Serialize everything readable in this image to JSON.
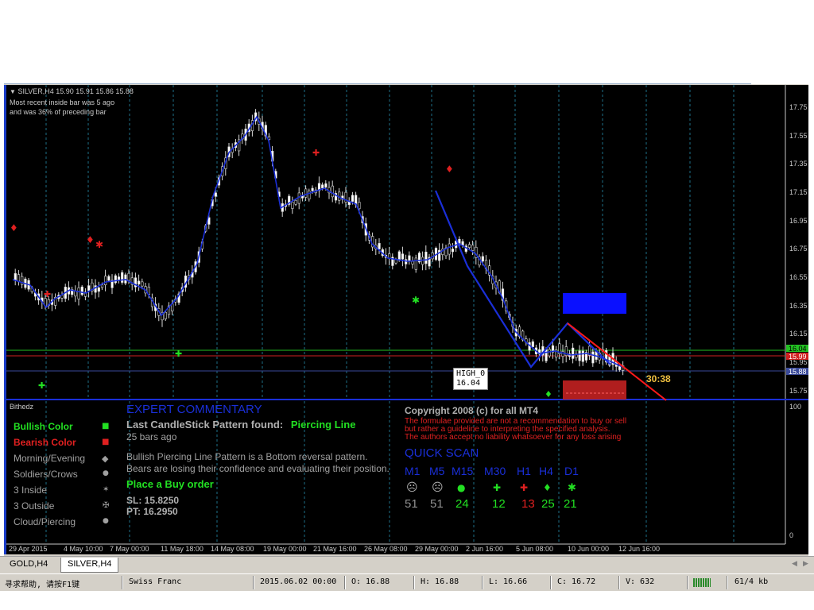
{
  "window": {
    "symbol_title": "SILVER,H4  15.90 15.91 15.86 15.88",
    "inside_bar_line1": "Most recent inside bar was 5 ago",
    "inside_bar_line2": "and was 36% of preceding bar"
  },
  "price_axis": [
    "17.75",
    "17.55",
    "17.35",
    "17.15",
    "16.95",
    "16.75",
    "16.55",
    "16.35",
    "16.15",
    "15.95",
    "15.75"
  ],
  "price_tags": {
    "green": "16.04",
    "red": "15.99",
    "blue": "15.88"
  },
  "indicator_axis": {
    "top": "100",
    "bottom": "0"
  },
  "time_axis": [
    "29 Apr 2015",
    "4 May 10:00",
    "7 May 00:00",
    "11 May 18:00",
    "14 May 08:00",
    "19 May 00:00",
    "21 May 16:00",
    "26 May 08:00",
    "29 May 00:00",
    "2 Jun 16:00",
    "5 Jun 08:00",
    "10 Jun 00:00",
    "12 Jun 16:00"
  ],
  "timer": "30:38",
  "high_label": {
    "name": "HIGH_0",
    "value": "16.04"
  },
  "indicator": {
    "name": "Bithedz",
    "legend": [
      {
        "label": "Bullish Color",
        "color": "#22e022",
        "marker": "■"
      },
      {
        "label": "Bearish Color",
        "color": "#e02020",
        "marker": "■"
      },
      {
        "label": "Morning/Evening",
        "color": "#a0a0a0",
        "marker": "◆"
      },
      {
        "label": "Soldiers/Crows",
        "color": "#a0a0a0",
        "marker": "●"
      },
      {
        "label": "3 Inside",
        "color": "#a0a0a0",
        "marker": "✶"
      },
      {
        "label": "3 Outside",
        "color": "#a0a0a0",
        "marker": "✠"
      },
      {
        "label": "Cloud/Piercing",
        "color": "#a0a0a0",
        "marker": "●"
      }
    ]
  },
  "commentary": {
    "heading": "EXPERT COMMENTARY",
    "last_pattern_prefix": "Last CandleStick Pattern found:",
    "last_pattern_name": "Piercing Line",
    "bars_ago": "25 bars ago",
    "desc1": "Bullish Piercing Line Pattern is a Bottom reversal pattern.",
    "desc2": "Bears are losing their confidence and evaluating their position.",
    "action": "Place a Buy order",
    "sl": "SL: 15.8250",
    "pt": "PT: 16.2950"
  },
  "copyright": {
    "title": "Copyright 2008 (c) for all MT4",
    "line1": "The formulae provided are not a recommendation to buy or sell",
    "line2": "but rather a guideline to interpreting the specified analysis.",
    "line3": "The authors accept no liability whatsoever for any loss arising"
  },
  "quick_scan": {
    "title": "QUICK SCAN",
    "columns": [
      {
        "tf": "M1",
        "icon": "☹",
        "icon_color": "#b0b0b0",
        "count": "51",
        "count_color": "#909090"
      },
      {
        "tf": "M5",
        "icon": "☹",
        "icon_color": "#b0b0b0",
        "count": "51",
        "count_color": "#909090"
      },
      {
        "tf": "M15",
        "icon": "●",
        "icon_color": "#22e022",
        "count": "24",
        "count_color": "#22e022"
      },
      {
        "tf": "M30",
        "icon": "✚",
        "icon_color": "#22e022",
        "count": "12",
        "count_color": "#22e022"
      },
      {
        "tf": "H1",
        "icon": "✚",
        "icon_color": "#e02020",
        "count": "13",
        "count_color": "#e02020"
      },
      {
        "tf": "H4",
        "icon": "♦",
        "icon_color": "#22e022",
        "count": "25",
        "count_color": "#22e022"
      },
      {
        "tf": "D1",
        "icon": "✱",
        "icon_color": "#22e022",
        "count": "21",
        "count_color": "#22e022"
      }
    ]
  },
  "tabs": [
    {
      "label": "GOLD,H4"
    },
    {
      "label": "SILVER,H4"
    }
  ],
  "status": {
    "help": "寻求帮助, 请按F1键",
    "profile": "Swiss Franc",
    "datetime": "2015.06.02 00:00",
    "open": "O: 16.88",
    "high": "H: 16.88",
    "low": "L: 16.66",
    "close": "C: 16.72",
    "volume": "V: 632",
    "traffic": "61/4 kb"
  },
  "colors": {
    "bull": "#22e022",
    "bear": "#e02020",
    "accent_blue": "#1a2fd8",
    "grid": "#1e6f87"
  }
}
